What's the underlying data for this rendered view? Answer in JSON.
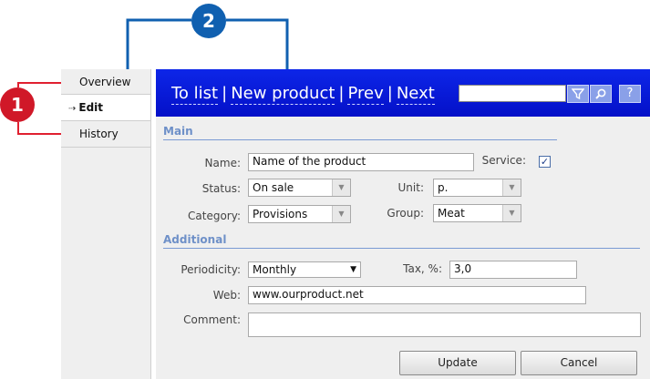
{
  "nav": {
    "items": [
      {
        "label": "Overview"
      },
      {
        "label": "Edit",
        "marker": "⇢"
      },
      {
        "label": "History"
      }
    ]
  },
  "toolbar": {
    "links": [
      "To list",
      "New product",
      "Prev",
      "Next"
    ],
    "separator": "|",
    "search_value": "",
    "filter_icon": "funnel-icon",
    "search_icon": "magnifier-icon",
    "help_label": "?"
  },
  "sections": {
    "main": "Main",
    "additional": "Additional"
  },
  "form": {
    "name_label": "Name:",
    "name_value": "Name of the product",
    "service_label": "Service:",
    "service_checked": "✓",
    "status_label": "Status:",
    "status_value": "On sale",
    "unit_label": "Unit:",
    "unit_value": "p.",
    "category_label": "Category:",
    "category_value": "Provisions",
    "group_label": "Group:",
    "group_value": "Meat",
    "periodicity_label": "Periodicity:",
    "periodicity_value": "Monthly",
    "tax_label": "Tax, %:",
    "tax_value": "3,0",
    "web_label": "Web:",
    "web_value": "www.ourproduct.net",
    "comment_label": "Comment:",
    "comment_value": ""
  },
  "buttons": {
    "update": "Update",
    "cancel": "Cancel"
  },
  "callouts": {
    "one": "1",
    "two": "2"
  },
  "colors": {
    "callout_red": "#d01828",
    "callout_blue": "#1060b0",
    "toolbar_blue": "#0a1ed8",
    "section_blue": "#6e90c8"
  }
}
